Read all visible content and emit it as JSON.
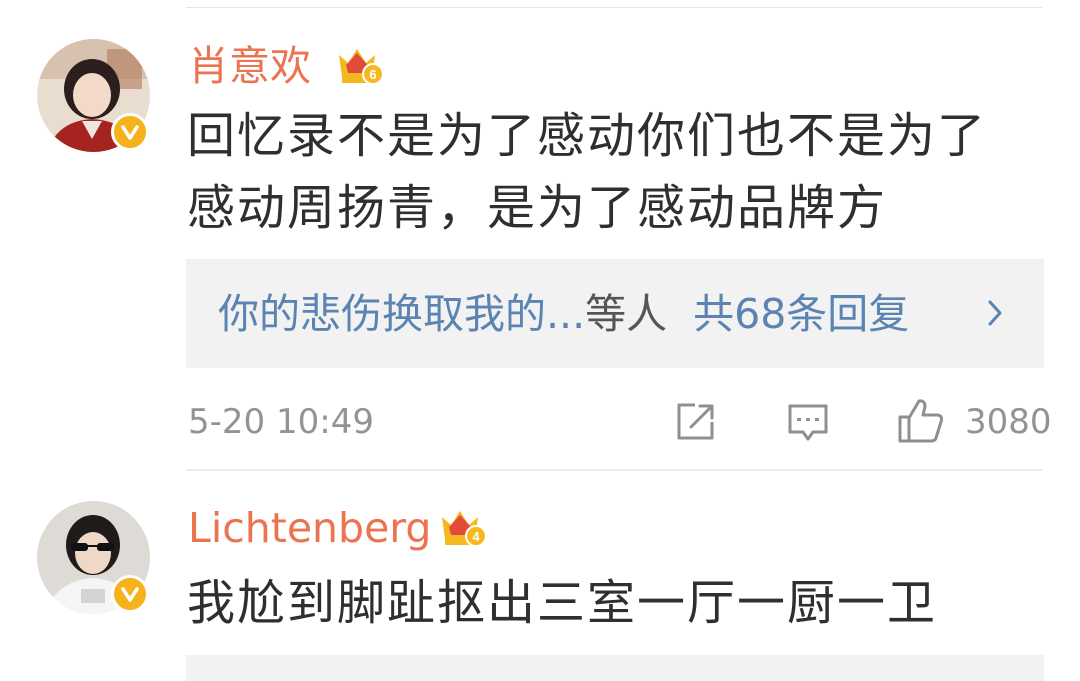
{
  "comments": [
    {
      "username": "肖意欢",
      "crown_level": "6",
      "avatar_icon": "user-avatar-photo",
      "verified_icon": "verified-v-icon",
      "content_lines": [
        "回忆录不是为了感动你们也不是为了",
        "感动周扬青，是为了感动品牌方"
      ],
      "replies": {
        "preview": "你的悲伤换取我的...",
        "etc": "等人",
        "count": "共68条回复"
      },
      "timestamp": "5-20 10:49",
      "likes": "3080"
    },
    {
      "username": "Lichtenberg",
      "crown_level": "4",
      "avatar_icon": "user-avatar-photo",
      "verified_icon": "verified-v-icon",
      "content_lines": [
        "我尬到脚趾抠出三室一厅一厨一卫"
      ]
    }
  ],
  "colors": {
    "username": "#eb7350",
    "link": "#5b84b2",
    "text": "#2f2f2f",
    "meta": "#939393",
    "crown": "#f6b81f",
    "verified_badge": "#f5b21b",
    "reply_bg": "#f2f2f2"
  },
  "icons": {
    "repost": "share-icon",
    "comment": "comment-icon",
    "like": "thumbs-up-icon",
    "more": "chevron-right-icon"
  }
}
